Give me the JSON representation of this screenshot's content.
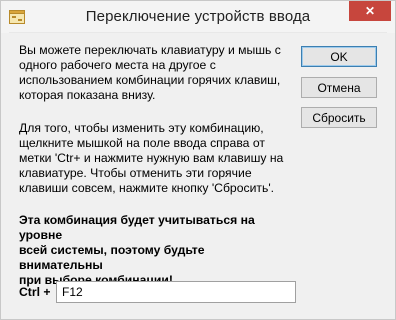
{
  "window": {
    "title": "Переключение устройств ввода",
    "close_glyph": "✕"
  },
  "content": {
    "paragraph1": "Вы можете переключать клавиатуру и мышь с\nодного рабочего места на другое с\nиспользованием комбинации горячих клавиш,\nкоторая показана внизу.",
    "paragraph2": "Для того, чтобы изменить эту комбинацию,\nщелкните мышкой на поле ввода справа от\nметки 'Ctr+ и нажмите нужную вам клавишу на\nклавиатуре. Чтобы отменить эти горячие\nклавиши совсем, нажмите кнопку 'Сбросить'.",
    "warning": "Эта комбинация будет учитываться на уровне\nвсей системы, поэтому будьте внимательны\nпри выборе комбинации!"
  },
  "buttons": {
    "ok": "OK",
    "cancel": "Отмена",
    "reset": "Сбросить"
  },
  "hotkey": {
    "label": "Ctrl +",
    "value": "F12"
  },
  "colors": {
    "close_button": "#c7463d",
    "default_button_border": "#3c7fb1",
    "dialog_background": "#f0f0f0"
  },
  "icons": {
    "app": "app-window-icon",
    "close": "close-icon"
  }
}
